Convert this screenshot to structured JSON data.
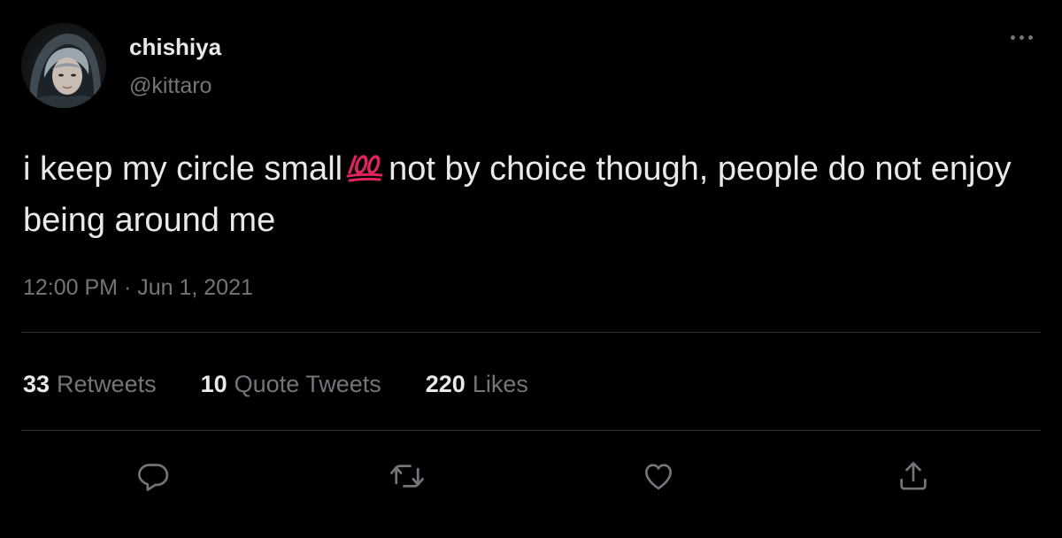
{
  "author": {
    "display_name": "chishiya",
    "handle": "@kittaro"
  },
  "tweet": {
    "text_part1": "i keep my circle small",
    "emoji": "100-emoji",
    "text_part2": "not by choice though, people do not enjoy being around me",
    "timestamp": "12:00 PM · Jun 1, 2021"
  },
  "stats": {
    "retweets_count": "33",
    "retweets_label": "Retweets",
    "quotes_count": "10",
    "quotes_label": "Quote Tweets",
    "likes_count": "220",
    "likes_label": "Likes"
  },
  "actions": {
    "reply_icon": "reply-icon",
    "retweet_icon": "retweet-icon",
    "like_icon": "heart-icon",
    "share_icon": "share-icon"
  },
  "colors": {
    "background": "#000000",
    "primary_text": "#e7e9ea",
    "secondary_text": "#71767b",
    "divider": "#2f3336",
    "emoji_red": "#e0245e"
  }
}
